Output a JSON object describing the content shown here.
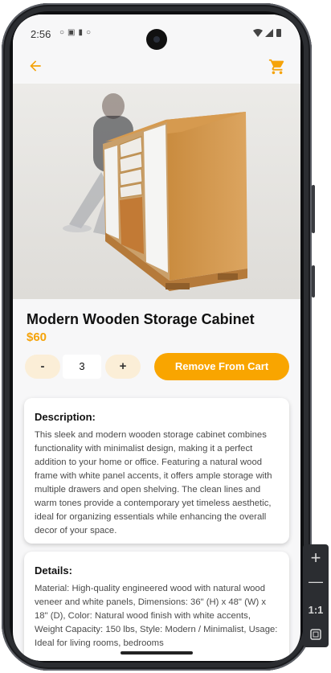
{
  "status_bar": {
    "time": "2:56"
  },
  "app_bar": {
    "back_icon": "arrow-back-icon",
    "cart_icon": "shopping-cart-icon"
  },
  "product": {
    "title": "Modern Wooden Storage Cabinet",
    "price": "$60",
    "quantity": "3",
    "minus_label": "-",
    "plus_label": "+",
    "remove_label": "Remove From Cart"
  },
  "description": {
    "heading": "Description:",
    "text": "This sleek and modern wooden storage cabinet combines functionality with minimalist design, making it a perfect addition to your home or office. Featuring a natural wood frame with white panel accents, it offers ample storage with multiple drawers and open shelving. The clean lines and warm tones provide a contemporary yet timeless aesthetic, ideal for organizing essentials while enhancing the overall decor of your space."
  },
  "details": {
    "heading": "Details:",
    "text": "Material: High-quality engineered wood with natural wood veneer and white panels, Dimensions: 36\" (H) x 48\" (W) x 18\" (D), Color: Natural wood finish with white accents, Weight Capacity: 150 lbs, Style: Modern / Minimalist, Usage: Ideal for living rooms, bedrooms"
  },
  "emulator_tools": {
    "ratio_label": "1:1"
  },
  "colors": {
    "accent": "#f9a500",
    "accent_soft": "#fbeed7",
    "background": "#f7f7f8"
  }
}
